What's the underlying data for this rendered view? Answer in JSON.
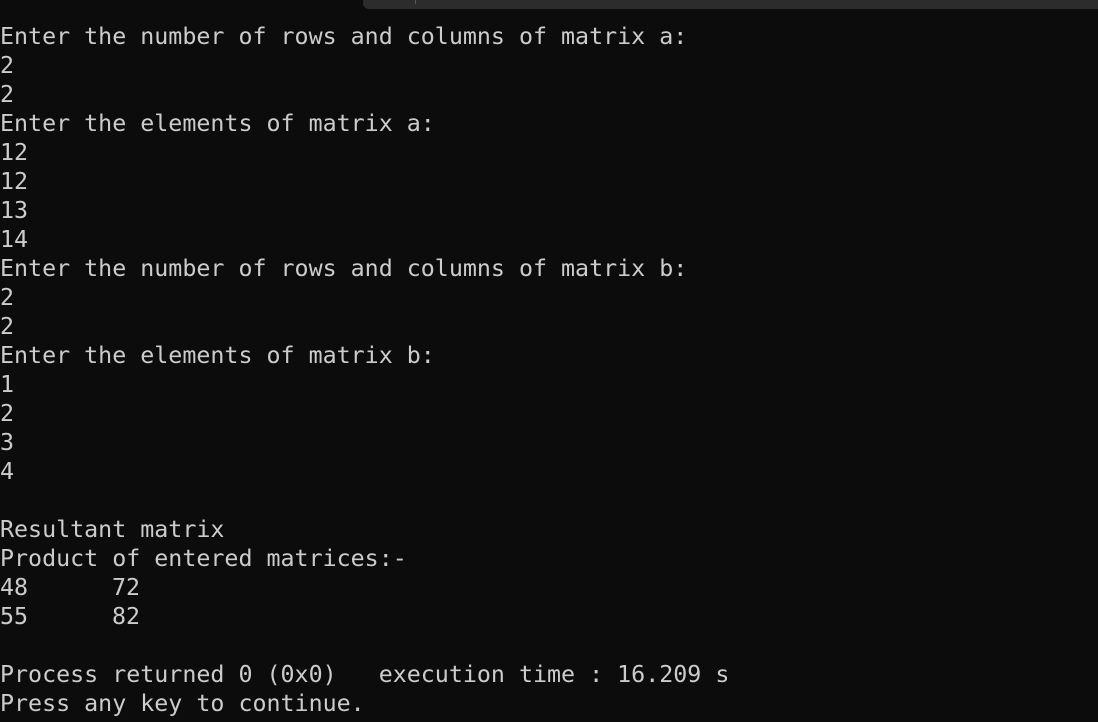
{
  "console": {
    "prompt_a_dims": "Enter the number of rows and columns of matrix a:",
    "a_rows": "2",
    "a_cols": "2",
    "prompt_a_elems": "Enter the elements of matrix a:",
    "a_elems": [
      "12",
      "12",
      "13",
      "14"
    ],
    "prompt_b_dims": "Enter the number of rows and columns of matrix b:",
    "b_rows": "2",
    "b_cols": "2",
    "prompt_b_elems": "Enter the elements of matrix b:",
    "b_elems": [
      "1",
      "2",
      "3",
      "4"
    ],
    "result_heading": "Resultant matrix",
    "product_heading": "Product of entered matrices:-",
    "result_rows": [
      [
        "48",
        "72"
      ],
      [
        "55",
        "82"
      ]
    ],
    "process_status": "Process returned 0 (0x0)   execution time : 16.209 s",
    "continue_prompt": "Press any key to continue."
  }
}
